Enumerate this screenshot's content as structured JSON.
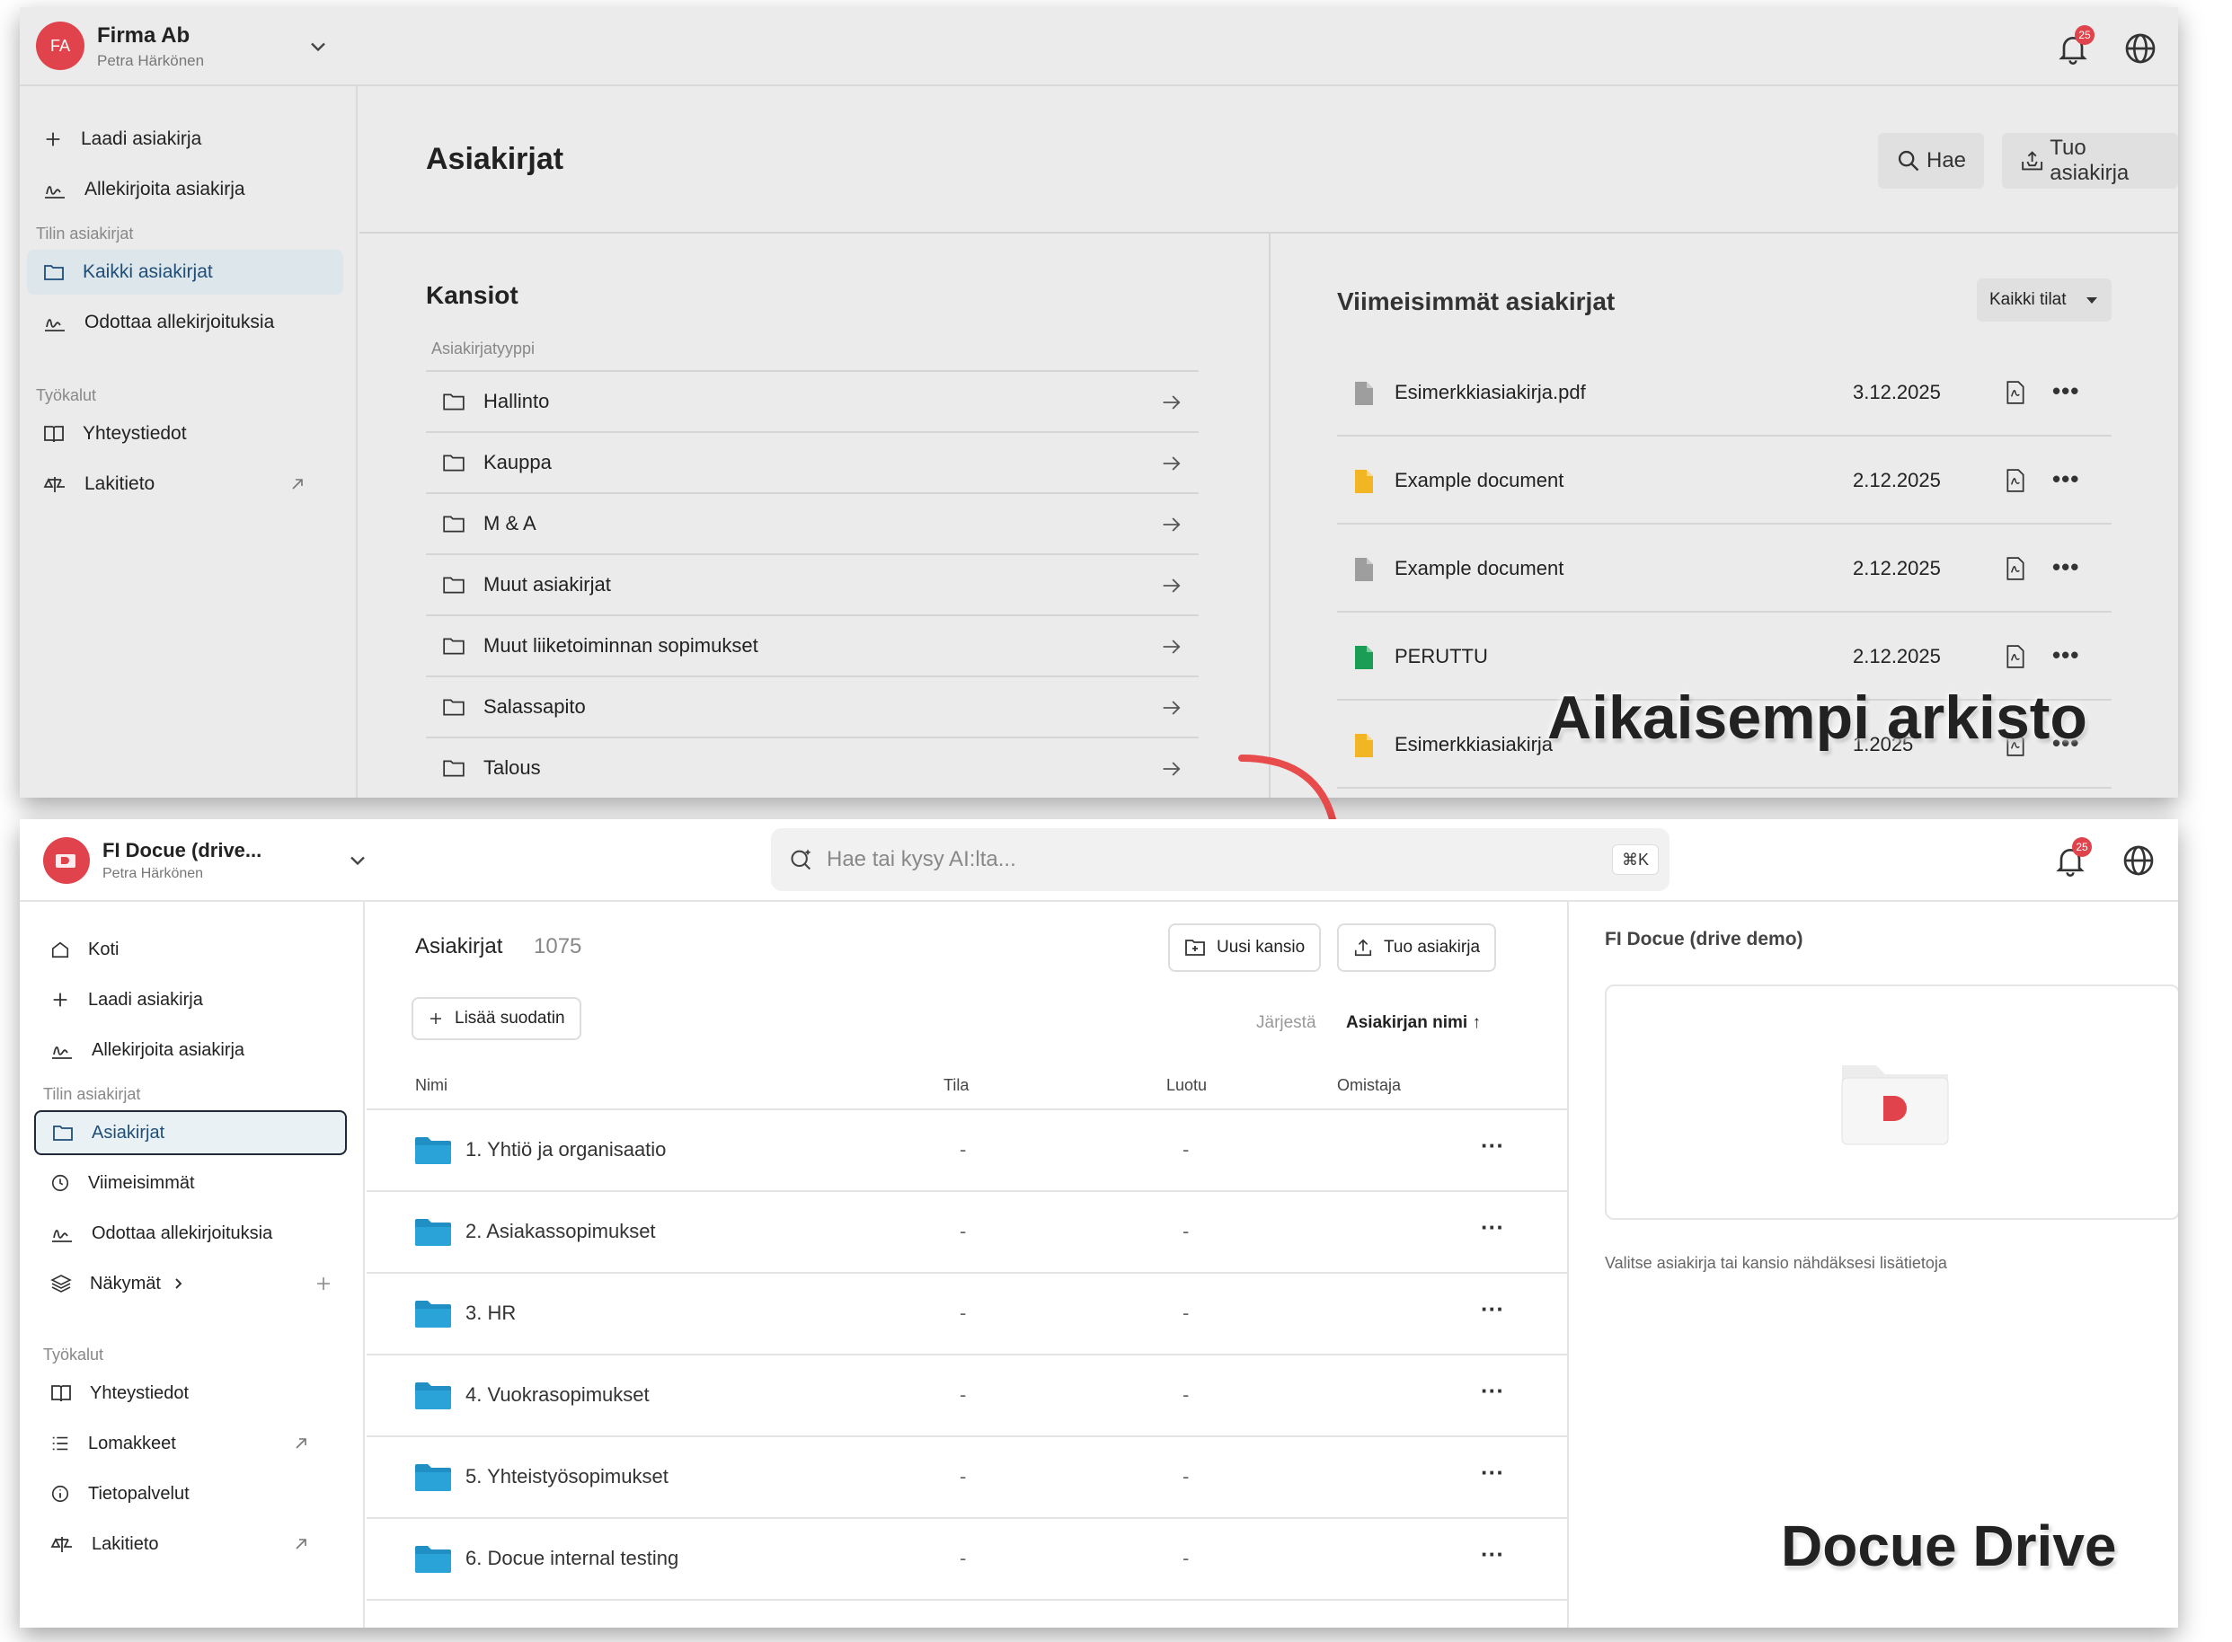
{
  "archive": {
    "header": {
      "avatar_initials": "FA",
      "org_name": "Firma Ab",
      "user_name": "Petra Härkönen",
      "notification_count": "25"
    },
    "sidebar": {
      "actions": [
        {
          "label": "Laadi asiakirja",
          "icon": "plus-icon"
        },
        {
          "label": "Allekirjoita asiakirja",
          "icon": "signature-icon"
        }
      ],
      "section_account": "Tilin asiakirjat",
      "account_items": [
        {
          "label": "Kaikki asiakirjat",
          "icon": "folder-icon",
          "active": true
        },
        {
          "label": "Odottaa allekirjoituksia",
          "icon": "signature-icon"
        }
      ],
      "section_tools": "Työkalut",
      "tool_items": [
        {
          "label": "Yhteystiedot",
          "icon": "book-icon"
        },
        {
          "label": "Lakitieto",
          "icon": "scale-icon",
          "external": true
        }
      ]
    },
    "page_title": "Asiakirjat",
    "search_label": "Hae",
    "import_label": "Tuo asiakirja",
    "folders": {
      "title": "Kansiot",
      "subtitle": "Asiakirjatyyppi",
      "items": [
        "Hallinto",
        "Kauppa",
        "M & A",
        "Muut asiakirjat",
        "Muut liiketoiminnan sopimukset",
        "Salassapito",
        "Talous"
      ]
    },
    "recent": {
      "title": "Viimeisimmät asiakirjat",
      "filter_label": "Kaikki tilat",
      "items": [
        {
          "name": "Esimerkkiasiakirja.pdf",
          "date": "3.12.2025",
          "color": "#9e9e9e"
        },
        {
          "name": "Example document",
          "date": "2.12.2025",
          "color": "#f2b624"
        },
        {
          "name": "Example document",
          "date": "2.12.2025",
          "color": "#9e9e9e"
        },
        {
          "name": "PERUTTU",
          "date": "2.12.2025",
          "color": "#1a9e56"
        },
        {
          "name": "Esimerkkiasiakirja",
          "date": "1.2025",
          "color": "#f2b624"
        }
      ]
    },
    "overlay_label": "Aikaisempi arkisto"
  },
  "drive": {
    "header": {
      "org_name": "FI Docue (drive...",
      "user_name": "Petra Härkönen",
      "search_placeholder": "Hae tai kysy AI:lta...",
      "search_shortcut": "⌘K",
      "notification_count": "25"
    },
    "sidebar": {
      "top_items": [
        {
          "label": "Koti",
          "icon": "home-icon"
        },
        {
          "label": "Laadi asiakirja",
          "icon": "plus-icon"
        },
        {
          "label": "Allekirjoita asiakirja",
          "icon": "signature-icon"
        }
      ],
      "section_account": "Tilin asiakirjat",
      "account_items": [
        {
          "label": "Asiakirjat",
          "icon": "folder-icon",
          "active": true
        },
        {
          "label": "Viimeisimmät",
          "icon": "clock-icon"
        },
        {
          "label": "Odottaa allekirjoituksia",
          "icon": "signature-icon"
        },
        {
          "label": "Näkymät",
          "icon": "layers-icon"
        }
      ],
      "section_tools": "Työkalut",
      "tool_items": [
        {
          "label": "Yhteystiedot",
          "icon": "book-icon"
        },
        {
          "label": "Lomakkeet",
          "icon": "list-icon",
          "external": true
        },
        {
          "label": "Tietopalvelut",
          "icon": "info-icon"
        },
        {
          "label": "Lakitieto",
          "icon": "scale-icon",
          "external": true
        }
      ]
    },
    "main": {
      "title": "Asiakirjat",
      "count": "1075",
      "new_folder_label": "Uusi kansio",
      "import_label": "Tuo asiakirja",
      "add_filter_label": "Lisää suodatin",
      "sort_label": "Järjestä",
      "sort_value": "Asiakirjan nimi ↑",
      "columns": {
        "name": "Nimi",
        "status": "Tila",
        "created": "Luotu",
        "owner": "Omistaja"
      },
      "rows": [
        {
          "name": "1. Yhtiö ja organisaatio",
          "status": "-",
          "created": "-"
        },
        {
          "name": "2. Asiakassopimukset",
          "status": "-",
          "created": "-"
        },
        {
          "name": "3. HR",
          "status": "-",
          "created": "-"
        },
        {
          "name": "4. Vuokrasopimukset",
          "status": "-",
          "created": "-"
        },
        {
          "name": "5. Yhteistyösopimukset",
          "status": "-",
          "created": "-"
        },
        {
          "name": "6. Docue internal testing",
          "status": "-",
          "created": "-"
        }
      ]
    },
    "details": {
      "title": "FI Docue (drive demo)",
      "hint": "Valitse asiakirja tai kansio nähdäksesi lisätietoja"
    },
    "overlay_label": "Docue Drive"
  },
  "colors": {
    "accent_red": "#e0434b",
    "folder_blue": "#1f8fc4",
    "active_bg": "#e9f1f5"
  }
}
